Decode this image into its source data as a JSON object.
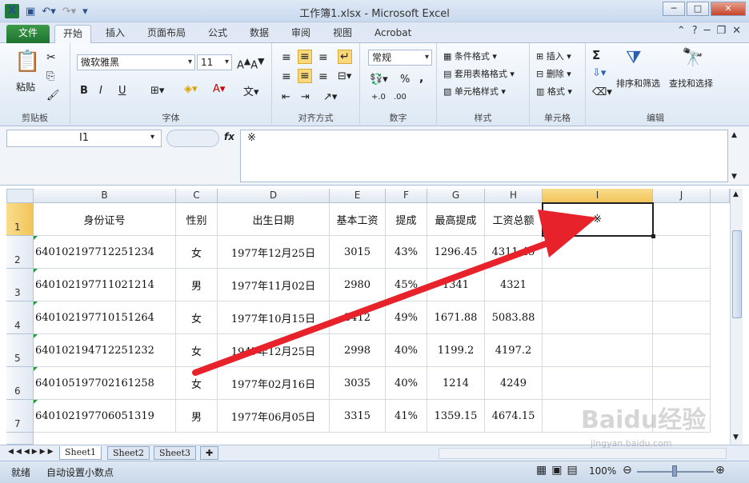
{
  "window": {
    "title": "工作簿1.xlsx - Microsoft Excel",
    "controls": [
      "─",
      "□",
      "✕"
    ]
  },
  "ribbon_tabs": [
    "文件",
    "开始",
    "插入",
    "页面布局",
    "公式",
    "数据",
    "审阅",
    "视图",
    "Acrobat"
  ],
  "active_tab": "开始",
  "ribbon": {
    "clipboard": {
      "paste": "粘贴",
      "label": "剪贴板"
    },
    "font": {
      "name": "微软雅黑",
      "size": "11",
      "bold": "B",
      "italic": "I",
      "underline": "U",
      "label": "字体"
    },
    "alignment": {
      "label": "对齐方式"
    },
    "number": {
      "format": "常规",
      "percent": "%",
      "comma": ",",
      "label": "数字"
    },
    "styles": {
      "conditional": "条件格式",
      "table": "套用表格格式",
      "cell": "单元格样式",
      "label": "样式"
    },
    "cells": {
      "insert": "插入",
      "delete": "删除",
      "format": "格式",
      "label": "单元格"
    },
    "editing": {
      "sum": "Σ",
      "sort": "排序和筛选",
      "find": "查找和选择",
      "label": "编辑"
    }
  },
  "formula_bar": {
    "name_box": "I1",
    "fx": "fx",
    "content": "※"
  },
  "columns": [
    "B",
    "C",
    "D",
    "E",
    "F",
    "G",
    "H",
    "I",
    "J"
  ],
  "selected_column": "I",
  "rows": [
    {
      "num": "1",
      "cells": [
        "身份证号",
        "性别",
        "出生日期",
        "基本工资",
        "提成",
        "最高提成",
        "工资总额",
        "※",
        ""
      ]
    },
    {
      "num": "2",
      "cells": [
        "640102197712251234",
        "女",
        "1977年12月25日",
        "3015",
        "43%",
        "1296.45",
        "4311.45",
        "",
        ""
      ]
    },
    {
      "num": "3",
      "cells": [
        "640102197711021214",
        "男",
        "1977年11月02日",
        "2980",
        "45%",
        "1341",
        "4321",
        "",
        ""
      ]
    },
    {
      "num": "4",
      "cells": [
        "640102197710151264",
        "女",
        "1977年10月15日",
        "3412",
        "49%",
        "1671.88",
        "5083.88",
        "",
        ""
      ]
    },
    {
      "num": "5",
      "cells": [
        "640102194712251232",
        "女",
        "1947年12月25日",
        "2998",
        "40%",
        "1199.2",
        "4197.2",
        "",
        ""
      ]
    },
    {
      "num": "6",
      "cells": [
        "640105197702161258",
        "女",
        "1977年02月16日",
        "3035",
        "40%",
        "1214",
        "4249",
        "",
        ""
      ]
    },
    {
      "num": "7",
      "cells": [
        "640102197706051319",
        "男",
        "1977年06月05日",
        "3315",
        "41%",
        "1359.15",
        "4674.15",
        "",
        ""
      ]
    }
  ],
  "sheets": [
    "Sheet1",
    "Sheet2",
    "Sheet3"
  ],
  "active_sheet": "Sheet1",
  "status": {
    "mode": "就绪",
    "auto_decimal": "自动设置小数点",
    "zoom": "100%"
  },
  "watermark": {
    "logo": "Baidu经验",
    "url": "jingyan.baidu.com"
  },
  "accent_color": "#1e7330",
  "arrow_color": "#e8222a"
}
